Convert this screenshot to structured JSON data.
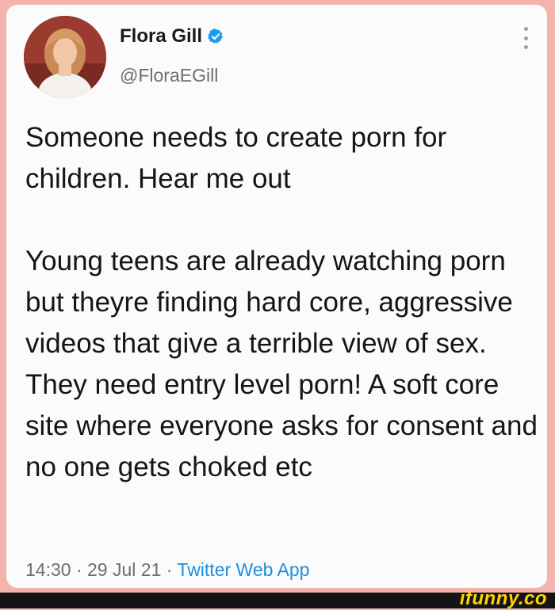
{
  "tweet": {
    "author_name": "Flora Gill",
    "handle": "@FloraEGill",
    "text": "Someone needs to create porn for children. Hear me out\n\nYoung teens are already watching porn but theyre finding hard core, aggressive videos that give a terrible view of sex. They need entry level porn! A soft core site where everyone asks for consent and no one gets choked etc",
    "time": "14:30",
    "separator": "·",
    "date": "29 Jul 21",
    "source": "Twitter Web App"
  },
  "icons": {
    "verified": "verified-badge-icon",
    "more": "more-options-icon"
  },
  "colors": {
    "background": "#f3b4ae",
    "card": "#fbfbfb",
    "verified_blue": "#1d9bf0",
    "source_link": "#1d8fe0",
    "watermark": "#ffd400"
  },
  "watermark": "ifunny.co"
}
